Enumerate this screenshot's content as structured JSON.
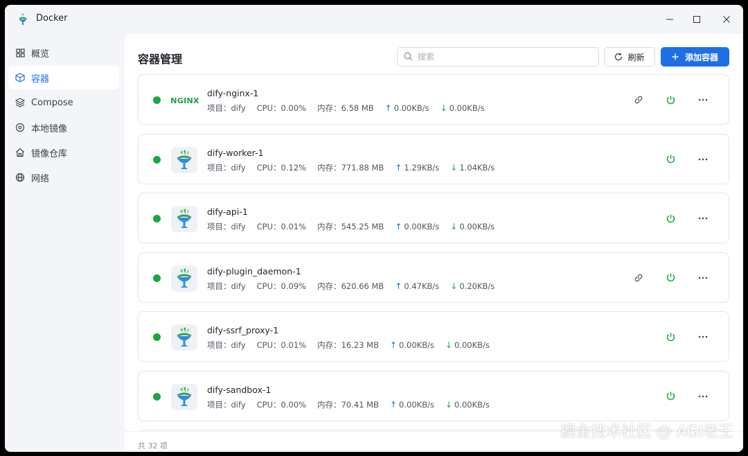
{
  "window": {
    "title": "Docker",
    "controls": [
      "minimize",
      "maximize",
      "close"
    ]
  },
  "sidebar": {
    "items": [
      {
        "label": "概览",
        "icon": "grid-icon",
        "active": false
      },
      {
        "label": "容器",
        "icon": "cube-icon",
        "active": true
      },
      {
        "label": "Compose",
        "icon": "layers-icon",
        "active": false
      },
      {
        "label": "本地镜像",
        "icon": "disc-icon",
        "active": false
      },
      {
        "label": "镜像仓库",
        "icon": "home-icon",
        "active": false
      },
      {
        "label": "网络",
        "icon": "globe-icon",
        "active": false
      }
    ]
  },
  "main": {
    "title": "容器管理",
    "search": {
      "placeholder": "搜索",
      "value": ""
    },
    "refresh_label": "刷新",
    "add_label": "添加容器",
    "footer_total": "共 32 项"
  },
  "colors": {
    "accent": "#1e6fe6",
    "running": "#1aa73d"
  },
  "labels": {
    "project": "项目：",
    "cpu": "CPU：",
    "memory": "内存："
  },
  "containers": [
    {
      "name": "dify-nginx-1",
      "logo": "nginx",
      "logo_text": "NGINX",
      "project": "dify",
      "cpu": "0.00%",
      "memory": "6.58 MB",
      "up": "0.00KB/s",
      "down": "0.00KB/s",
      "has_link": true
    },
    {
      "name": "dify-worker-1",
      "logo": "dify",
      "project": "dify",
      "cpu": "0.12%",
      "memory": "771.88 MB",
      "up": "1.29KB/s",
      "down": "1.04KB/s",
      "has_link": false
    },
    {
      "name": "dify-api-1",
      "logo": "dify",
      "project": "dify",
      "cpu": "0.01%",
      "memory": "545.25 MB",
      "up": "0.00KB/s",
      "down": "0.00KB/s",
      "has_link": false
    },
    {
      "name": "dify-plugin_daemon-1",
      "logo": "dify",
      "project": "dify",
      "cpu": "0.09%",
      "memory": "620.66 MB",
      "up": "0.47KB/s",
      "down": "0.20KB/s",
      "has_link": true
    },
    {
      "name": "dify-ssrf_proxy-1",
      "logo": "dify",
      "project": "dify",
      "cpu": "0.01%",
      "memory": "16.23 MB",
      "up": "0.00KB/s",
      "down": "0.00KB/s",
      "has_link": false
    },
    {
      "name": "dify-sandbox-1",
      "logo": "dify",
      "project": "dify",
      "cpu": "0.00%",
      "memory": "70.41 MB",
      "up": "0.00KB/s",
      "down": "0.00KB/s",
      "has_link": false
    }
  ],
  "watermark": "掘金技术社区 @ AGI老王"
}
